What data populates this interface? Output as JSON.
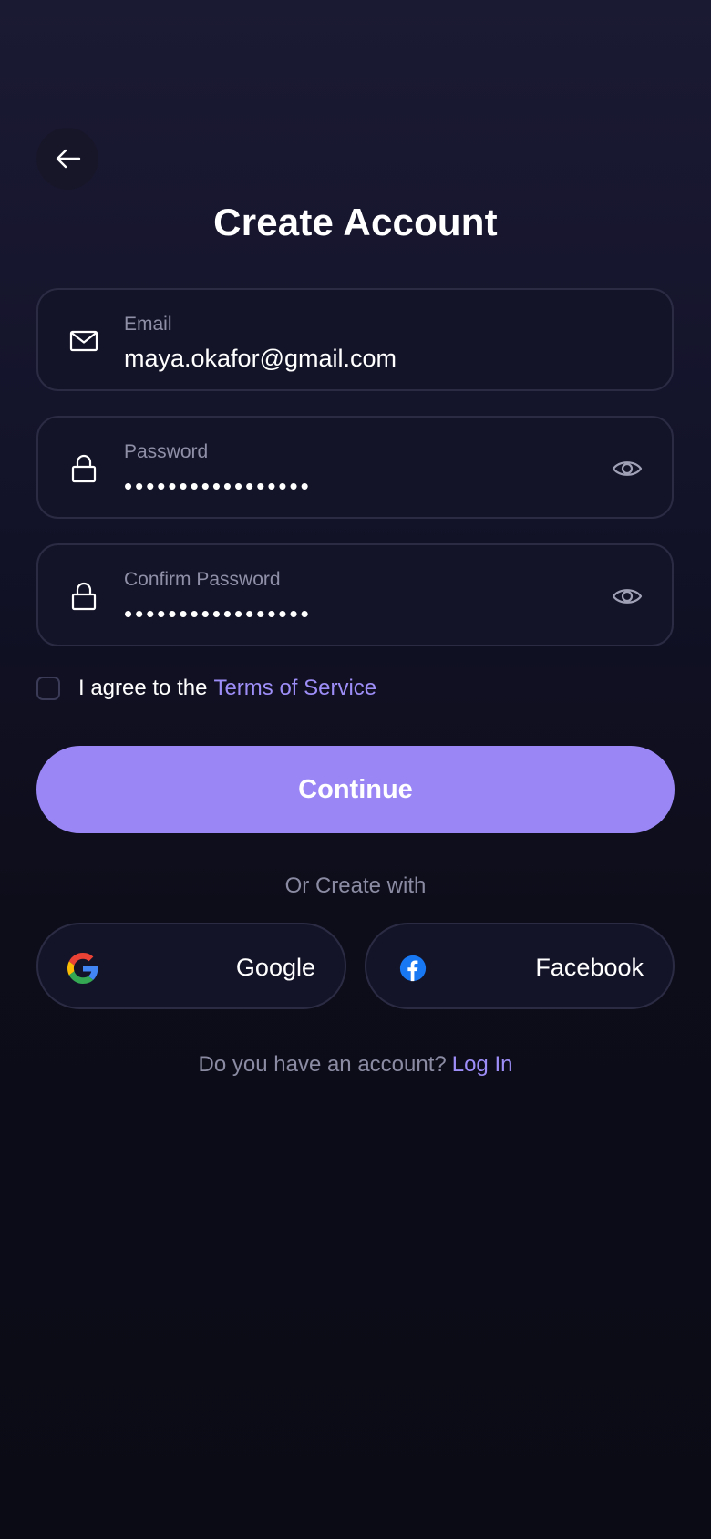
{
  "header": {
    "back_icon": "arrow-left-icon",
    "title": "Create Account"
  },
  "form": {
    "email": {
      "label": "Email",
      "value": "maya.okafor@gmail.com",
      "icon": "mail-icon"
    },
    "password": {
      "label": "Password",
      "value": "•••••••••••••••••",
      "icon": "lock-icon",
      "toggle_icon": "eye-icon"
    },
    "confirm_password": {
      "label": "Confirm Password",
      "value": "•••••••••••••••••",
      "icon": "lock-icon",
      "toggle_icon": "eye-icon"
    },
    "terms": {
      "checked": false,
      "text": "I agree to the",
      "link": "Terms of Service"
    },
    "continue_label": "Continue"
  },
  "social": {
    "divider": "Or Create with",
    "google_label": "Google",
    "facebook_label": "Facebook"
  },
  "footer": {
    "question": "Do you have an account?",
    "login_link": "Log In"
  },
  "colors": {
    "accent": "#9a87f5",
    "link": "#9d8df7",
    "background_top": "#1b1a33",
    "background_bottom": "#0b0b16",
    "field_bg": "#141428",
    "field_border": "#2b2b44",
    "muted_text": "#8b8ba3"
  }
}
